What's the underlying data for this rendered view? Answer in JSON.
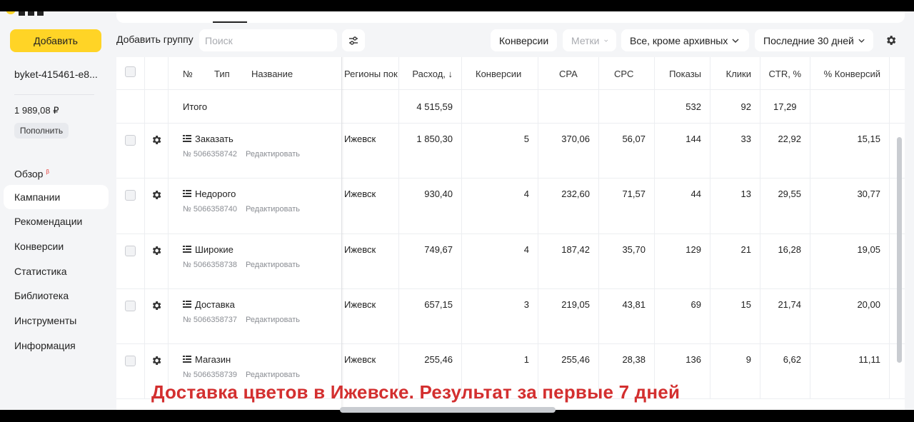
{
  "sidebar": {
    "add_label": "Добавить",
    "account": "byket-415461-e8...",
    "balance": "1 989,08 ₽",
    "topup_label": "Пополнить",
    "nav": [
      {
        "label": "Обзор",
        "badge": "β"
      },
      {
        "label": "Кампании"
      },
      {
        "label": "Рекомендации"
      },
      {
        "label": "Конверсии"
      },
      {
        "label": "Статистика"
      },
      {
        "label": "Библиотека"
      },
      {
        "label": "Инструменты"
      },
      {
        "label": "Информация"
      }
    ]
  },
  "toolbar": {
    "add_group": "Добавить группу",
    "search_placeholder": "Поиск",
    "conversions": "Конверсии",
    "tags": "Метки",
    "filter_status": "Все, кроме архивных",
    "period": "Последние 30 дней"
  },
  "table": {
    "headers": {
      "num": "№",
      "type": "Тип",
      "name": "Название",
      "regions": "Регионы пок",
      "spend": "Расход, ↓",
      "conversions": "Конверсии",
      "cpa": "CPA",
      "cpc": "CPC",
      "impressions": "Показы",
      "clicks": "Клики",
      "ctr": "CTR, %",
      "conv_rate": "% Конверсий"
    },
    "total": {
      "label": "Итого",
      "spend": "4 515,59",
      "impressions": "532",
      "clicks": "92",
      "ctr": "17,29"
    },
    "edit_label": "Редактировать",
    "rows": [
      {
        "name": "Заказать",
        "id": "№ 5066358742",
        "region": "Ижевск",
        "spend": "1 850,30",
        "conversions": "5",
        "cpa": "370,06",
        "cpc": "56,07",
        "impressions": "144",
        "clicks": "33",
        "ctr": "22,92",
        "conv_rate": "15,15"
      },
      {
        "name": "Недорого",
        "id": "№ 5066358740",
        "region": "Ижевск",
        "spend": "930,40",
        "conversions": "4",
        "cpa": "232,60",
        "cpc": "71,57",
        "impressions": "44",
        "clicks": "13",
        "ctr": "29,55",
        "conv_rate": "30,77"
      },
      {
        "name": "Широкие",
        "id": "№ 5066358738",
        "region": "Ижевск",
        "spend": "749,67",
        "conversions": "4",
        "cpa": "187,42",
        "cpc": "35,70",
        "impressions": "129",
        "clicks": "21",
        "ctr": "16,28",
        "conv_rate": "19,05"
      },
      {
        "name": "Доставка",
        "id": "№ 5066358737",
        "region": "Ижевск",
        "spend": "657,15",
        "conversions": "3",
        "cpa": "219,05",
        "cpc": "43,81",
        "impressions": "69",
        "clicks": "15",
        "ctr": "21,74",
        "conv_rate": "20,00"
      },
      {
        "name": "Магазин",
        "id": "№ 5066358739",
        "region": "Ижевск",
        "spend": "255,46",
        "conversions": "1",
        "cpa": "255,46",
        "cpc": "28,38",
        "impressions": "136",
        "clicks": "9",
        "ctr": "6,62",
        "conv_rate": "11,11"
      }
    ]
  },
  "caption": "Доставка цветов в Ижевске. Результат за первые 7 дней",
  "colors": {
    "accent": "#ffd426",
    "caption": "#d32f2f"
  }
}
